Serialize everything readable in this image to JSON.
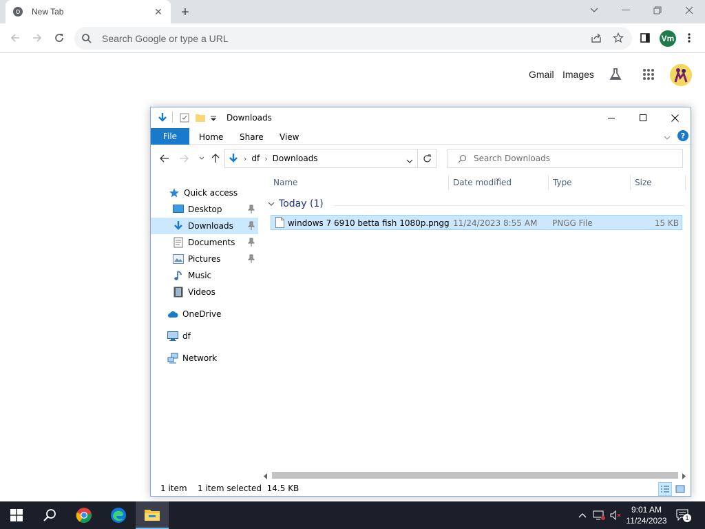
{
  "browser": {
    "tab_title": "New Tab",
    "omnibox_placeholder": "Search Google or type a URL",
    "profile_initials": "Vm"
  },
  "new_tab_page": {
    "gmail_link": "Gmail",
    "images_link": "Images"
  },
  "explorer": {
    "title": "Downloads",
    "ribbon_tabs": {
      "file": "File",
      "home": "Home",
      "share": "Share",
      "view": "View"
    },
    "help_label": "?",
    "address": {
      "root": "df",
      "folder": "Downloads"
    },
    "search_placeholder": "Search Downloads",
    "nav_items": {
      "quick_access": "Quick access",
      "desktop": "Desktop",
      "downloads": "Downloads",
      "documents": "Documents",
      "pictures": "Pictures",
      "music": "Music",
      "videos": "Videos",
      "onedrive": "OneDrive",
      "this_pc": "df",
      "network": "Network"
    },
    "columns": {
      "name": "Name",
      "date_modified": "Date modified",
      "type": "Type",
      "size": "Size"
    },
    "group_label": "Today (1)",
    "files": [
      {
        "name": "windows 7 6910 betta fish 1080p.pngg",
        "date_modified": "11/24/2023 8:55 AM",
        "type": "PNGG File",
        "size": "15 KB"
      }
    ],
    "status": {
      "item_count": "1 item",
      "selection": "1 item selected  14.5 KB"
    }
  },
  "taskbar": {
    "clock_time": "9:01 AM",
    "clock_date": "11/24/2023",
    "notification_count": "1"
  },
  "colors": {
    "explorer_accent": "#1979ca",
    "selection_bg": "#cce8ff",
    "taskbar_bg": "#1b1f2a",
    "chrome_tabbar_bg": "#dee1e6"
  }
}
